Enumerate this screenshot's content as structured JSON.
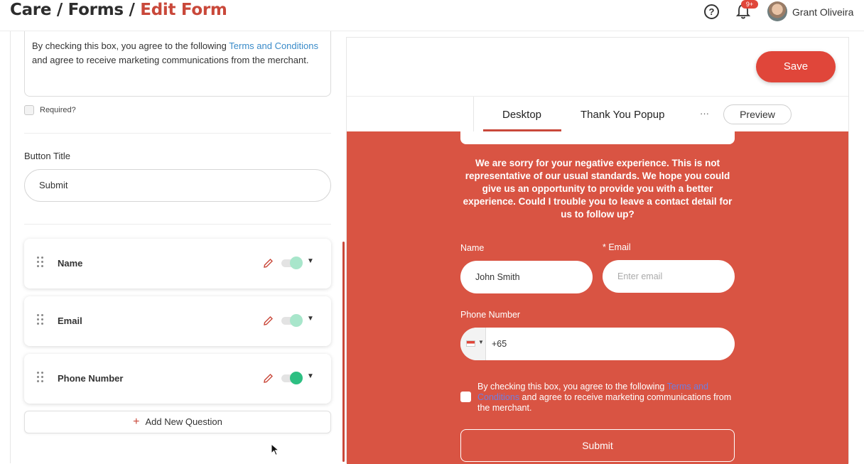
{
  "breadcrumb": {
    "part1": "Care",
    "sep1": " / ",
    "part2": "Forms",
    "sep2": " / ",
    "current": "Edit Form"
  },
  "header": {
    "help_icon": "?",
    "notif_badge": "9+",
    "user_name": "Grant Oliveira"
  },
  "left": {
    "terms_text_before": "By checking this box, you agree to the following ",
    "terms_link": "Terms and Conditions",
    "terms_text_after": " and agree to receive marketing communications from the merchant.",
    "required_label": "Required?",
    "button_title_label": "Button Title",
    "button_title_value": "Submit",
    "questions": [
      {
        "name": "Name",
        "enabled": false
      },
      {
        "name": "Email",
        "enabled": false
      },
      {
        "name": "Phone Number",
        "enabled": true
      }
    ],
    "add_question_label": "Add New Question"
  },
  "right": {
    "save_label": "Save",
    "tabs": [
      "Desktop",
      "Thank You Popup"
    ],
    "more_label": "···",
    "preview_label": "Preview",
    "message": "We are sorry for your negative experience. This is not representative of our usual standards. We hope you could give us an opportunity to provide you with a better experience. Could I trouble you to leave a contact detail for us to follow up?",
    "name_label": "Name",
    "name_value": "John Smith",
    "email_label": "* Email",
    "email_placeholder": "Enter email",
    "phone_label": "Phone Number",
    "phone_value": "+65",
    "consent_before": "By checking this box, you agree to the following ",
    "consent_link": "Terms and Conditions",
    "consent_after": " and agree to receive marketing communications from the merchant.",
    "submit_label": "Submit"
  },
  "colors": {
    "accent": "#c9483a",
    "save_button": "#e0463a",
    "canvas_bg": "#d95443",
    "toggle_on": "#2dbf82",
    "toggle_off": "#a8e6cb"
  }
}
